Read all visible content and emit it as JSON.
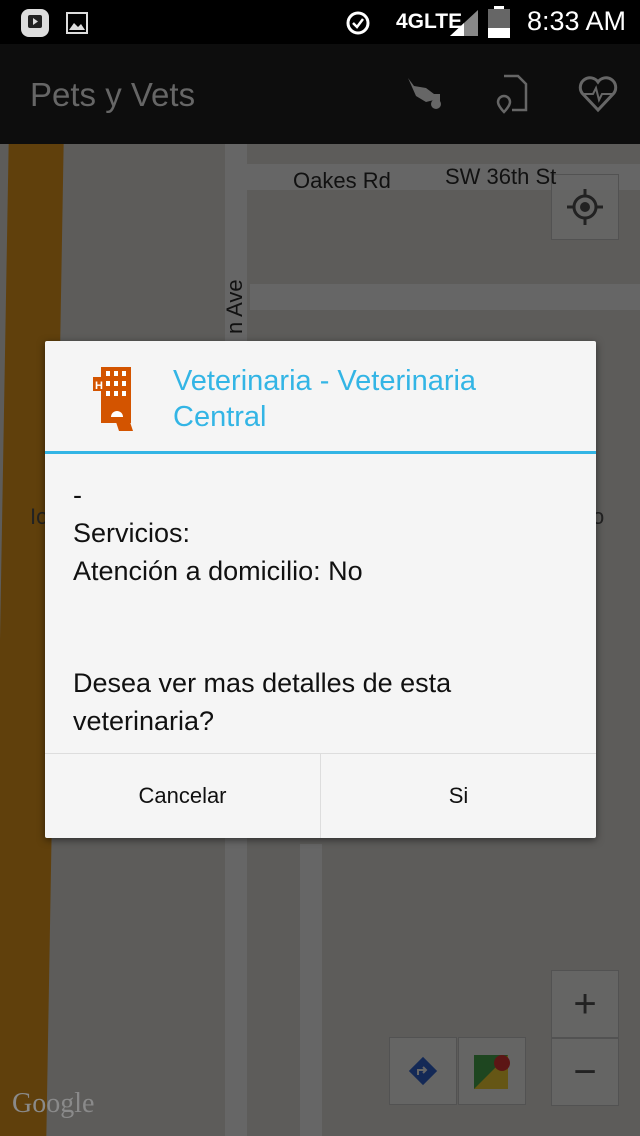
{
  "status_bar": {
    "network": "4GLTE",
    "time": "8:33 AM"
  },
  "app_bar": {
    "title": "Pets y Vets",
    "icons": [
      "pets-icon",
      "map-document-icon",
      "heart-pulse-icon"
    ]
  },
  "map": {
    "labels": {
      "oakes": "Oakes Rd",
      "sw36": "SW 36th St",
      "ave": "n Ave",
      "left_partial": "Io",
      "right_partial": "o"
    },
    "watermark": "Google"
  },
  "dialog": {
    "title": "Veterinaria - Veterinaria Central",
    "body_lines": [
      "-",
      "Servicios:",
      "Atención a domicilio: No",
      "",
      "Desea ver mas detalles de esta veterinaria?"
    ],
    "cancel": "Cancelar",
    "confirm": "Si"
  },
  "colors": {
    "accent": "#33b5e5",
    "icon": "#d35400"
  }
}
